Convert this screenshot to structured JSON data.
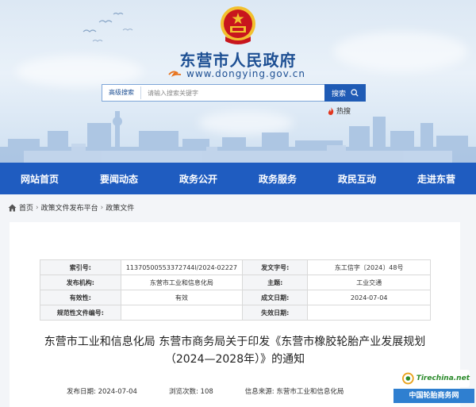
{
  "header": {
    "site_name": "东营市人民政府",
    "site_url": "www.dongying.gov.cn",
    "search": {
      "advanced_label": "高级搜索",
      "placeholder": "请输入搜索关键字",
      "button_label": "搜索"
    },
    "hot_label": "热搜"
  },
  "nav": {
    "items": [
      {
        "label": "网站首页"
      },
      {
        "label": "要闻动态"
      },
      {
        "label": "政务公开"
      },
      {
        "label": "政务服务"
      },
      {
        "label": "政民互动"
      },
      {
        "label": "走进东营"
      }
    ]
  },
  "breadcrumb": {
    "home": "首页",
    "sep": "›",
    "level1": "政策文件发布平台",
    "level2": "政策文件"
  },
  "meta": {
    "rows": [
      {
        "k1": "索引号:",
        "v1": "11370500553372744l/2024-02227",
        "k2": "发文字号:",
        "v2": "东工信字〔2024〕48号"
      },
      {
        "k1": "发布机构:",
        "v1": "东营市工业和信息化局",
        "k2": "主题:",
        "v2": "工业交通"
      },
      {
        "k1": "有效性:",
        "v1": "有效",
        "k2": "成文日期:",
        "v2": "2024-07-04"
      },
      {
        "k1": "规范性文件编号:",
        "v1": "",
        "k2": "失效日期:",
        "v2": ""
      }
    ]
  },
  "article": {
    "title_line1": "东营市工业和信息化局 东营市商务局关于印发《东营市橡胶轮胎产业发展规划",
    "title_line2": "（2024—2028年）》的通知"
  },
  "footer_meta": {
    "publish_date": "发布日期:  2024-07-04",
    "views": "浏览次数:  108",
    "source": "信息来源:  东营市工业和信息化局"
  },
  "watermark": {
    "logo_text": "Tirechina.net",
    "cn_text": "中国轮胎商务网"
  },
  "colors": {
    "brand_blue": "#1f5cc0",
    "title_blue": "#1d4f93",
    "emblem_red": "#c8161d",
    "emblem_gold": "#f2c12e"
  }
}
